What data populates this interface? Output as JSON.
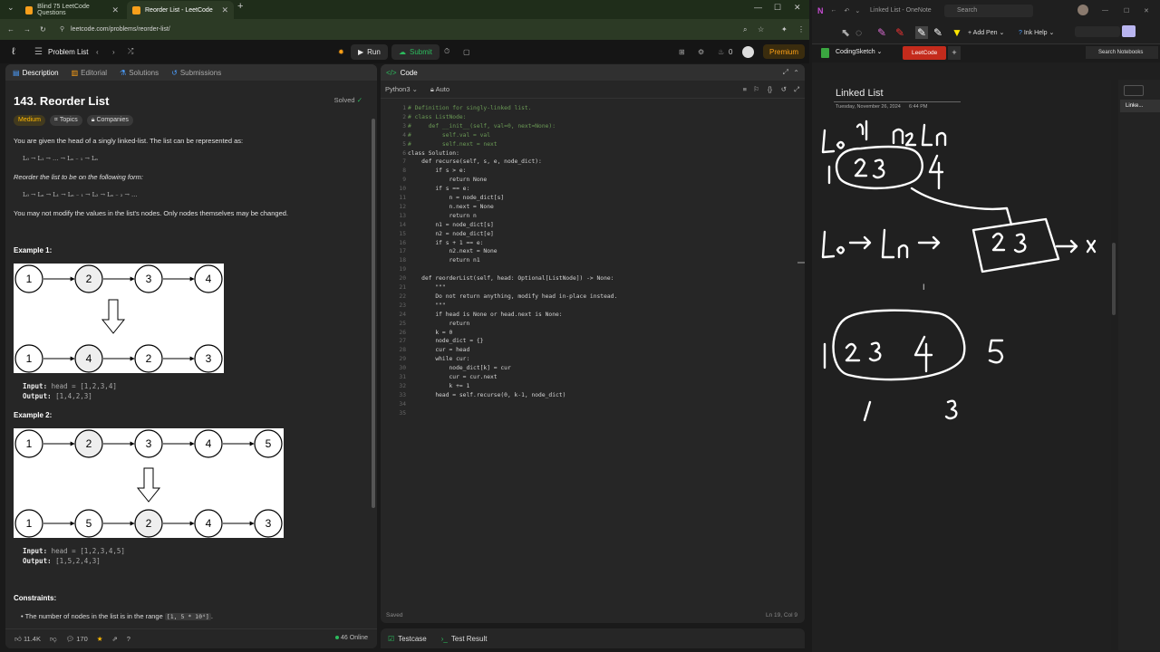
{
  "browser": {
    "tabs": [
      {
        "title": "Blind 75 LeetCode Questions"
      },
      {
        "title": "Reorder List - LeetCode"
      }
    ],
    "url": "leetcode.com/problems/reorder-list/"
  },
  "lc_nav": {
    "problem_list": "Problem List",
    "run": "Run",
    "submit": "Submit",
    "streak": "0",
    "premium": "Premium"
  },
  "left_tabs": [
    "Description",
    "Editorial",
    "Solutions",
    "Submissions"
  ],
  "problem": {
    "title": "143. Reorder List",
    "solved": "Solved",
    "difficulty": "Medium",
    "topics": "Topics",
    "companies": "Companies",
    "intro": "You are given the head of a singly linked-list. The list can be represented as:",
    "form1": "L₀ → L₁ → … → Lₙ ₋ ₁ → Lₙ",
    "reorder_text": "Reorder the list to be on the following form:",
    "form2": "L₀ → Lₙ → L₁ → Lₙ ₋ ₁ → L₂ → Lₙ ₋ ₂ → …",
    "note": "You may not modify the values in the list's nodes. Only nodes themselves may be changed.",
    "example1_title": "Example 1:",
    "example1_top": [
      "1",
      "2",
      "3",
      "4"
    ],
    "example1_bottom": [
      "1",
      "4",
      "2",
      "3"
    ],
    "example1_input": "head = [1,2,3,4]",
    "example1_output": "[1,4,2,3]",
    "example2_title": "Example 2:",
    "example2_top": [
      "1",
      "2",
      "3",
      "4",
      "5"
    ],
    "example2_bottom": [
      "1",
      "5",
      "2",
      "4",
      "3"
    ],
    "example2_input": "head = [1,2,3,4,5]",
    "example2_output": "[1,5,2,4,3]",
    "input_label": "Input:",
    "output_label": "Output:",
    "constraints_title": "Constraints:",
    "constraint1": "The number of nodes in the list is in the range",
    "constraint1_code": "[1, 5 * 10⁴]",
    "constraint1_end": "."
  },
  "left_footer": {
    "likes": "11.4K",
    "comments": "170",
    "online": "46 Online"
  },
  "code_panel": {
    "title": "Code",
    "language": "Python3",
    "auto": "Auto",
    "lines": [
      "# Definition for singly-linked list.",
      "# class ListNode:",
      "#     def __init__(self, val=0, next=None):",
      "#         self.val = val",
      "#         self.next = next",
      "class Solution:",
      "    def recurse(self, s, e, node_dict):",
      "        if s > e:",
      "            return None",
      "        if s == e:",
      "            n = node_dict[s]",
      "            n.next = None",
      "            return n",
      "        n1 = node_dict[s]",
      "        n2 = node_dict[e]",
      "        if s + 1 == e:",
      "            n2.next = None",
      "            return n1",
      "",
      "    def reorderList(self, head: Optional[ListNode]) -> None:",
      "        \"\"\"",
      "        Do not return anything, modify head in-place instead.",
      "        \"\"\"",
      "        if head is None or head.next is None:",
      "            return",
      "        k = 0",
      "        node_dict = {}",
      "        cur = head",
      "        while cur:",
      "            node_dict[k] = cur",
      "            cur = cur.next",
      "            k += 1",
      "        head = self.recurse(0, k-1, node_dict)",
      "",
      ""
    ],
    "saved": "Saved",
    "cursor_pos": "Ln 19, Col 9"
  },
  "test_panel": {
    "testcase": "Testcase",
    "test_result": "Test Result"
  },
  "onenote": {
    "window_title": "Linked List - OneNote",
    "search": "Search",
    "add_pen": "Add Pen",
    "ink_help": "Ink Help",
    "notebook": "CodingSketch",
    "section": "LeetCode",
    "search_notebooks": "Search Notebooks",
    "page_title": "Linked List",
    "page_date": "Tuesday, November 26, 2024",
    "page_time": "6:44 PM",
    "page_list_item": "Linke..."
  },
  "colors": {
    "accent_green": "#2cbb5d",
    "leetcode_orange": "#ffa116",
    "medium_yellow": "#ffb800",
    "onenote_red": "#c42b1c"
  }
}
